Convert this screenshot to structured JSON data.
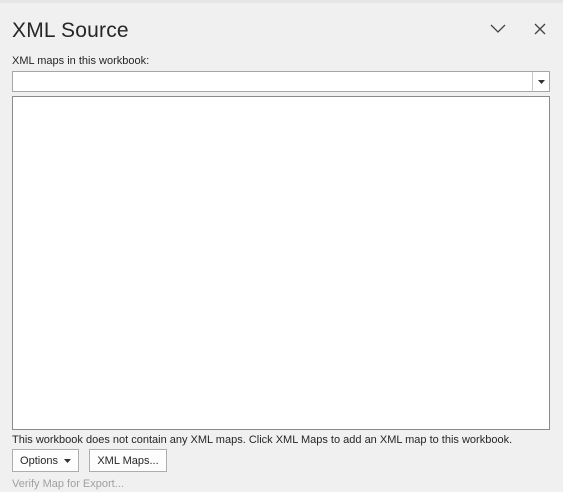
{
  "pane": {
    "title": "XML Source"
  },
  "maps": {
    "label": "XML maps in this workbook:",
    "selected": ""
  },
  "status": {
    "message": "This workbook does not contain any XML maps. Click XML Maps to add an XML map to this workbook."
  },
  "buttons": {
    "options_label": "Options",
    "xml_maps_label": "XML Maps..."
  },
  "links": {
    "verify_label": "Verify Map for Export..."
  },
  "colors": {
    "background": "#f0f0f0",
    "panel_white": "#ffffff",
    "text": "#262626",
    "disabled_text": "#a0a0a0"
  },
  "icons": {
    "collapse": "chevron-down-icon",
    "close": "close-icon",
    "dropdown": "caret-down-icon"
  }
}
